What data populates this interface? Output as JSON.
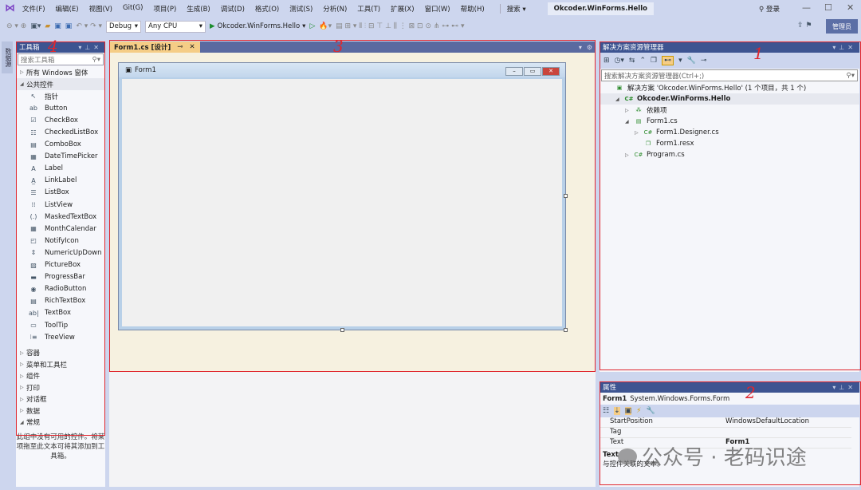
{
  "menubar": {
    "items": [
      "文件(F)",
      "编辑(E)",
      "视图(V)",
      "Git(G)",
      "项目(P)",
      "生成(B)",
      "调试(D)",
      "格式(O)",
      "测试(S)",
      "分析(N)",
      "工具(T)",
      "扩展(X)",
      "窗口(W)",
      "帮助(H)"
    ],
    "search": "搜索 ▾",
    "title": "Okcoder.WinForms.Hello",
    "login": "登录"
  },
  "toolbar": {
    "config": "Debug",
    "platform": "Any CPU",
    "run_target": "Okcoder.WinForms.Hello",
    "admin": "管理员"
  },
  "sidetab": "数据源",
  "toolbox": {
    "title": "工具箱",
    "search_placeholder": "搜索工具箱",
    "all_windows": "所有 Windows 窗体",
    "common": "公共控件",
    "items": [
      {
        "icon": "pointer",
        "label": "指针"
      },
      {
        "icon": "ab",
        "label": "Button"
      },
      {
        "icon": "☑",
        "label": "CheckBox"
      },
      {
        "icon": "☷",
        "label": "CheckedListBox"
      },
      {
        "icon": "▤",
        "label": "ComboBox"
      },
      {
        "icon": "▦",
        "label": "DateTimePicker"
      },
      {
        "icon": "A",
        "label": "Label"
      },
      {
        "icon": "A̲",
        "label": "LinkLabel"
      },
      {
        "icon": "☰",
        "label": "ListBox"
      },
      {
        "icon": "⁞⁞",
        "label": "ListView"
      },
      {
        "icon": "(.)",
        "label": "MaskedTextBox"
      },
      {
        "icon": "▦",
        "label": "MonthCalendar"
      },
      {
        "icon": "◰",
        "label": "NotifyIcon"
      },
      {
        "icon": "⇕",
        "label": "NumericUpDown"
      },
      {
        "icon": "▨",
        "label": "PictureBox"
      },
      {
        "icon": "▬",
        "label": "ProgressBar"
      },
      {
        "icon": "◉",
        "label": "RadioButton"
      },
      {
        "icon": "▤",
        "label": "RichTextBox"
      },
      {
        "icon": "ab|",
        "label": "TextBox"
      },
      {
        "icon": "▭",
        "label": "ToolTip"
      },
      {
        "icon": "⁝≡",
        "label": "TreeView"
      }
    ],
    "categories": [
      "容器",
      "菜单和工具栏",
      "组件",
      "打印",
      "对话框",
      "数据",
      "常规"
    ],
    "empty_text": "此组中没有可用的控件。将某项拖至此文本可将其添加到工具箱。"
  },
  "editor": {
    "tab_label": "Form1.cs [设计]",
    "form_title": "Form1"
  },
  "solution_explorer": {
    "title": "解决方案资源管理器",
    "search_placeholder": "搜索解决方案资源管理器(Ctrl+;)",
    "rows": [
      {
        "indent": 0,
        "arrow": "",
        "icon": "▣",
        "label": "解决方案 'Okcoder.WinForms.Hello' (1 个项目，共 1 个)"
      },
      {
        "indent": 1,
        "arrow": "◢",
        "icon": "C#",
        "label": "Okcoder.WinForms.Hello",
        "bold": true
      },
      {
        "indent": 2,
        "arrow": "▷",
        "icon": "⁂",
        "label": "依赖项"
      },
      {
        "indent": 2,
        "arrow": "◢",
        "icon": "▤",
        "label": "Form1.cs"
      },
      {
        "indent": 3,
        "arrow": "▷",
        "icon": "C#",
        "label": "Form1.Designer.cs"
      },
      {
        "indent": 3,
        "arrow": "",
        "icon": "❐",
        "label": "Form1.resx"
      },
      {
        "indent": 2,
        "arrow": "▷",
        "icon": "C#",
        "label": "Program.cs"
      }
    ]
  },
  "properties": {
    "title": "属性",
    "object_name": "Form1",
    "object_type": "System.Windows.Forms.Form",
    "rows": [
      {
        "name": "StartPosition",
        "value": "WindowsDefaultLocation"
      },
      {
        "name": "Tag",
        "value": ""
      },
      {
        "name": "Text",
        "value": "Form1"
      }
    ],
    "desc_title": "Text",
    "desc": "与控件关联的文本。"
  },
  "annotations": [
    "1",
    "2",
    "3",
    "4"
  ],
  "watermark": "公众号 · 老码识途",
  "colors": {
    "accent": "#3d5491",
    "annotation": "#e0262e",
    "active_tab": "#f5cd86"
  }
}
